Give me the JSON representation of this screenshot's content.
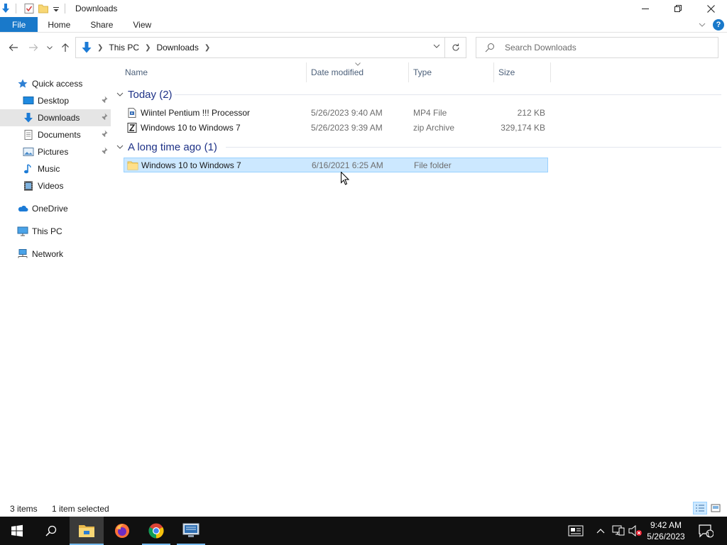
{
  "window": {
    "title": "Downloads"
  },
  "ribbon": {
    "tabs": [
      "File",
      "Home",
      "Share",
      "View"
    ],
    "help": "?"
  },
  "address": {
    "crumbs": [
      "This PC",
      "Downloads"
    ]
  },
  "search": {
    "placeholder": "Search Downloads"
  },
  "nav": {
    "items": [
      {
        "label": "Quick access",
        "icon": "star-icon"
      },
      {
        "label": "Desktop",
        "icon": "desktop-icon",
        "pinned": true
      },
      {
        "label": "Downloads",
        "icon": "download-arrow-icon",
        "pinned": true,
        "selected": true
      },
      {
        "label": "Documents",
        "icon": "documents-icon",
        "pinned": true
      },
      {
        "label": "Pictures",
        "icon": "pictures-icon",
        "pinned": true
      },
      {
        "label": "Music",
        "icon": "music-icon"
      },
      {
        "label": "Videos",
        "icon": "videos-icon"
      },
      {
        "label": "OneDrive",
        "icon": "cloud-icon"
      },
      {
        "label": "This PC",
        "icon": "computer-icon"
      },
      {
        "label": "Network",
        "icon": "network-icon"
      }
    ]
  },
  "columns": {
    "name": "Name",
    "date": "Date modified",
    "type": "Type",
    "size": "Size"
  },
  "groups": [
    {
      "label": "Today (2)",
      "files": [
        {
          "name": "Wiintel Pentium !!! Processor",
          "date": "5/26/2023 9:40 AM",
          "type": "MP4 File",
          "size": "212 KB",
          "icon": "video-file-icon"
        },
        {
          "name": "Windows 10 to Windows 7",
          "date": "5/26/2023 9:39 AM",
          "type": "zip Archive",
          "size": "329,174 KB",
          "icon": "zip-file-icon"
        }
      ]
    },
    {
      "label": "A long time ago (1)",
      "files": [
        {
          "name": "Windows 10 to Windows 7",
          "date": "6/16/2021 6:25 AM",
          "type": "File folder",
          "size": "",
          "icon": "folder-icon",
          "selected": true
        }
      ]
    }
  ],
  "status": {
    "count": "3 items",
    "selection": "1 item selected"
  },
  "taskbar": {
    "time": "9:42 AM",
    "date": "5/26/2023",
    "notifications": "1"
  },
  "colors": {
    "accent": "#1979ca",
    "selection": "#cce8ff",
    "group_header": "#1e3287",
    "taskbar": "#101010"
  }
}
